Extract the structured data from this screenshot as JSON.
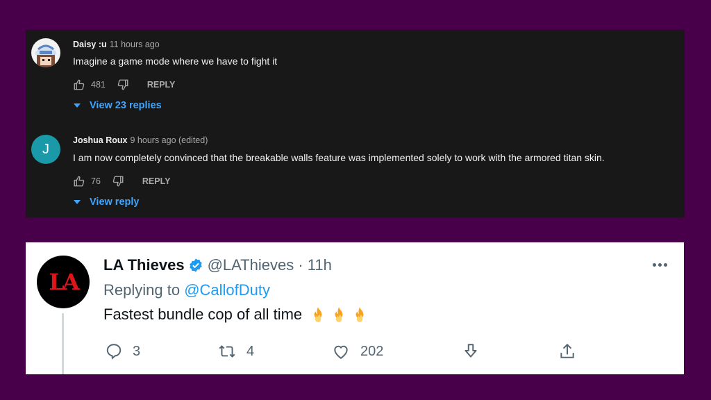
{
  "youtube_comments": [
    {
      "author": "Daisy :u",
      "time": "11 hours ago",
      "text": "Imagine a game mode where we have to fight it",
      "likes": "481",
      "reply_label": "REPLY",
      "replies_label": "View 23 replies",
      "avatar": "anime-character-avatar"
    },
    {
      "author": "Joshua Roux",
      "time": "9 hours ago (edited)",
      "text": "I am now completely convinced that the breakable walls feature was implemented solely to work with the armored titan skin.",
      "likes": "76",
      "reply_label": "REPLY",
      "replies_label": "View reply",
      "avatar_letter": "J",
      "avatar_color": "#1a9aa8"
    }
  ],
  "tweet": {
    "name": "LA Thieves",
    "verified": true,
    "handle": "@LAThieves · 11h",
    "replying_prefix": "Replying to ",
    "replying_to": "@CallofDuty",
    "text": "Fastest bundle cop of all time",
    "emoji": [
      "fire-icon",
      "fire-icon",
      "fire-icon"
    ],
    "avatar_text": "LA",
    "stats": {
      "replies": "3",
      "retweets": "4",
      "likes": "202"
    }
  },
  "colors": {
    "background": "#48004a",
    "youtube_panel": "#181818",
    "youtube_link": "#3ea6ff",
    "twitter_link": "#1d9bf0"
  }
}
